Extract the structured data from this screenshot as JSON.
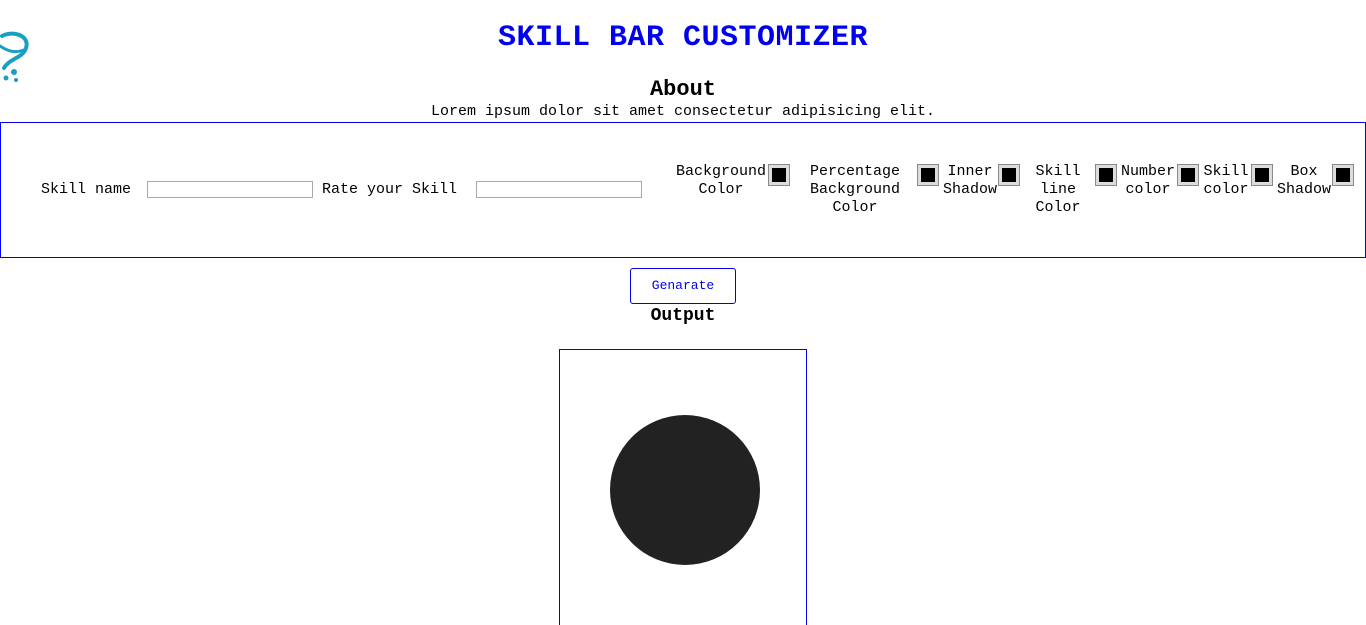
{
  "header": {
    "title": "SKILL BAR CUSTOMIZER",
    "logo_icon": "hook-logo-icon"
  },
  "about": {
    "heading": "About",
    "text": "Lorem ipsum dolor sit amet consectetur adipisicing elit."
  },
  "form": {
    "skill_name_label": "Skill name",
    "skill_name_value": "",
    "rate_label": "Rate your Skill",
    "rate_value": "",
    "color_fields": [
      {
        "label": "Background Color",
        "value": "#000000"
      },
      {
        "label": "Percentage Background Color",
        "value": "#000000"
      },
      {
        "label": "Inner Shadow",
        "value": "#000000"
      },
      {
        "label": "Skill line Color",
        "value": "#000000"
      },
      {
        "label": "Number color",
        "value": "#000000"
      },
      {
        "label": "Skill color",
        "value": "#000000"
      },
      {
        "label": "Box Shadow",
        "value": "#000000"
      }
    ]
  },
  "actions": {
    "generate_label": "Genarate"
  },
  "output": {
    "heading": "Output",
    "circle_color": "#222222"
  },
  "colors": {
    "accent": "#0000ee",
    "logo": "#1a9fc4"
  }
}
